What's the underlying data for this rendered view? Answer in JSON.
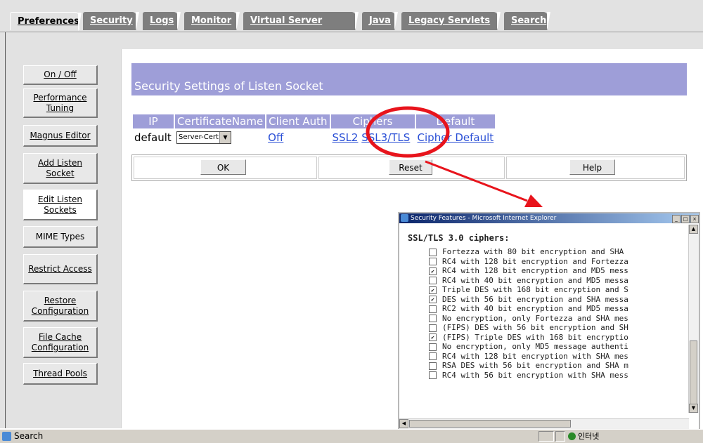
{
  "tabs": [
    {
      "label": "Preferences",
      "active": true
    },
    {
      "label": "Security"
    },
    {
      "label": "Logs"
    },
    {
      "label": "Monitor"
    },
    {
      "label": "Virtual Server Class"
    },
    {
      "label": "Java"
    },
    {
      "label": "Legacy Servlets"
    },
    {
      "label": "Search"
    }
  ],
  "sidebar": {
    "items": [
      {
        "label": "On / Off"
      },
      {
        "label": "Performance Tuning"
      },
      {
        "label": "Magnus Editor"
      },
      {
        "label": "Add Listen Socket"
      },
      {
        "label": "Edit Listen Sockets",
        "active": true
      },
      {
        "label": "MIME Types"
      },
      {
        "label": "Restrict Access"
      },
      {
        "label": "Restore Configuration"
      },
      {
        "label": "File Cache Configuration"
      },
      {
        "label": "Thread Pools"
      }
    ]
  },
  "main": {
    "title": "Security Settings of Listen Socket",
    "table": {
      "headers": [
        "IP",
        "CertificateName",
        "Client Auth",
        "Ciphers",
        "Default"
      ],
      "row": {
        "ip": "default",
        "cert": "Server-Cert",
        "client_auth": "Off",
        "cipher_ssl2": "SSL2",
        "cipher_ssl3": "SSL3/TLS",
        "default": "Cipher Default"
      }
    },
    "buttons": {
      "ok": "OK",
      "reset": "Reset",
      "help": "Help"
    }
  },
  "popup": {
    "title": "Security Features - Microsoft Internet Explorer",
    "heading": "SSL/TLS 3.0 ciphers:",
    "ciphers": [
      {
        "label": "Fortezza with 80 bit encryption and SHA",
        "checked": false
      },
      {
        "label": "RC4 with 128 bit encryption and Fortezza",
        "checked": false
      },
      {
        "label": "RC4 with 128 bit encryption and MD5 mess",
        "checked": true
      },
      {
        "label": "RC4 with 40 bit encryption and MD5 messa",
        "checked": false
      },
      {
        "label": "Triple DES with 168 bit encryption and S",
        "checked": true
      },
      {
        "label": "DES with 56 bit encryption and SHA messa",
        "checked": true
      },
      {
        "label": "RC2 with 40 bit encryption and MD5 messa",
        "checked": false
      },
      {
        "label": "No encryption, only Fortezza and SHA mes",
        "checked": false
      },
      {
        "label": "(FIPS) DES with 56 bit encryption and SH",
        "checked": false
      },
      {
        "label": "(FIPS) Triple DES with 168 bit encryptio",
        "checked": true
      },
      {
        "label": "No encryption, only MD5 message authenti",
        "checked": false
      },
      {
        "label": "RC4 with 128 bit encryption with SHA mes",
        "checked": false
      },
      {
        "label": "RSA DES with 56 bit encryption and SHA m",
        "checked": false
      },
      {
        "label": "RC4 with 56 bit encryption with SHA mess",
        "checked": false
      }
    ]
  },
  "status": {
    "left": "Search",
    "zone": "인터넷"
  },
  "annotation": {
    "color": "#e8141c"
  }
}
